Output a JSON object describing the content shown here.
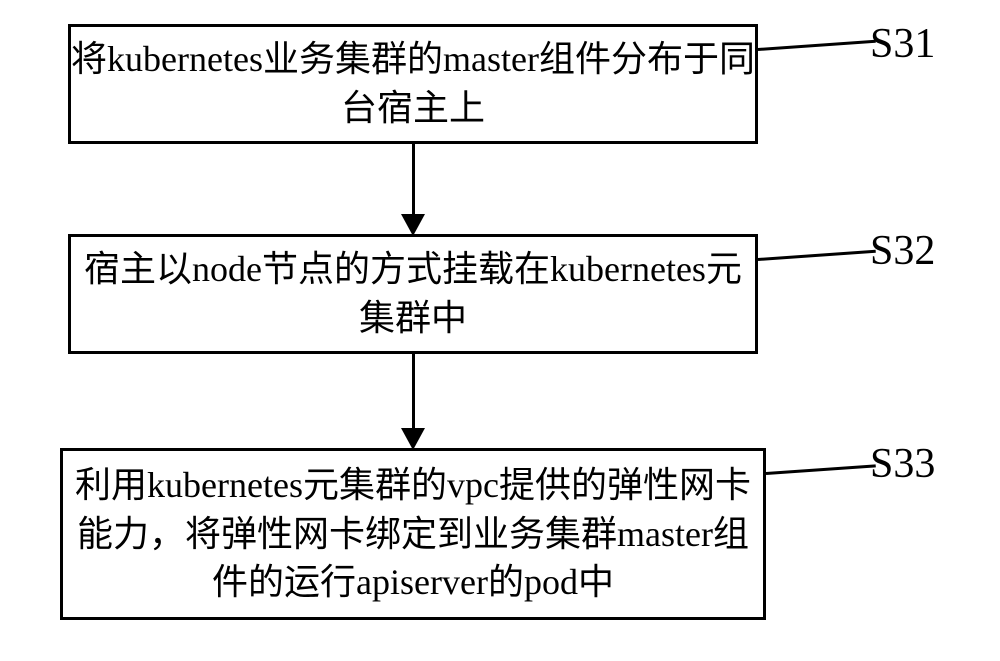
{
  "steps": [
    {
      "id": "S31",
      "text": "将kubernetes业务集群的master组件分布于同台宿主上"
    },
    {
      "id": "S32",
      "text": "宿主以node节点的方式挂载在kubernetes元集群中"
    },
    {
      "id": "S33",
      "text": "利用kubernetes元集群的vpc提供的弹性网卡能力，将弹性网卡绑定到业务集群master组件的运行apiserver的pod中"
    }
  ],
  "chart_data": {
    "type": "flowchart",
    "direction": "top-to-bottom",
    "nodes": [
      {
        "id": "S31",
        "label": "将kubernetes业务集群的master组件分布于同台宿主上"
      },
      {
        "id": "S32",
        "label": "宿主以node节点的方式挂载在kubernetes元集群中"
      },
      {
        "id": "S33",
        "label": "利用kubernetes元集群的vpc提供的弹性网卡能力，将弹性网卡绑定到业务集群master组件的运行apiserver的pod中"
      }
    ],
    "edges": [
      {
        "from": "S31",
        "to": "S32"
      },
      {
        "from": "S32",
        "to": "S33"
      }
    ]
  }
}
